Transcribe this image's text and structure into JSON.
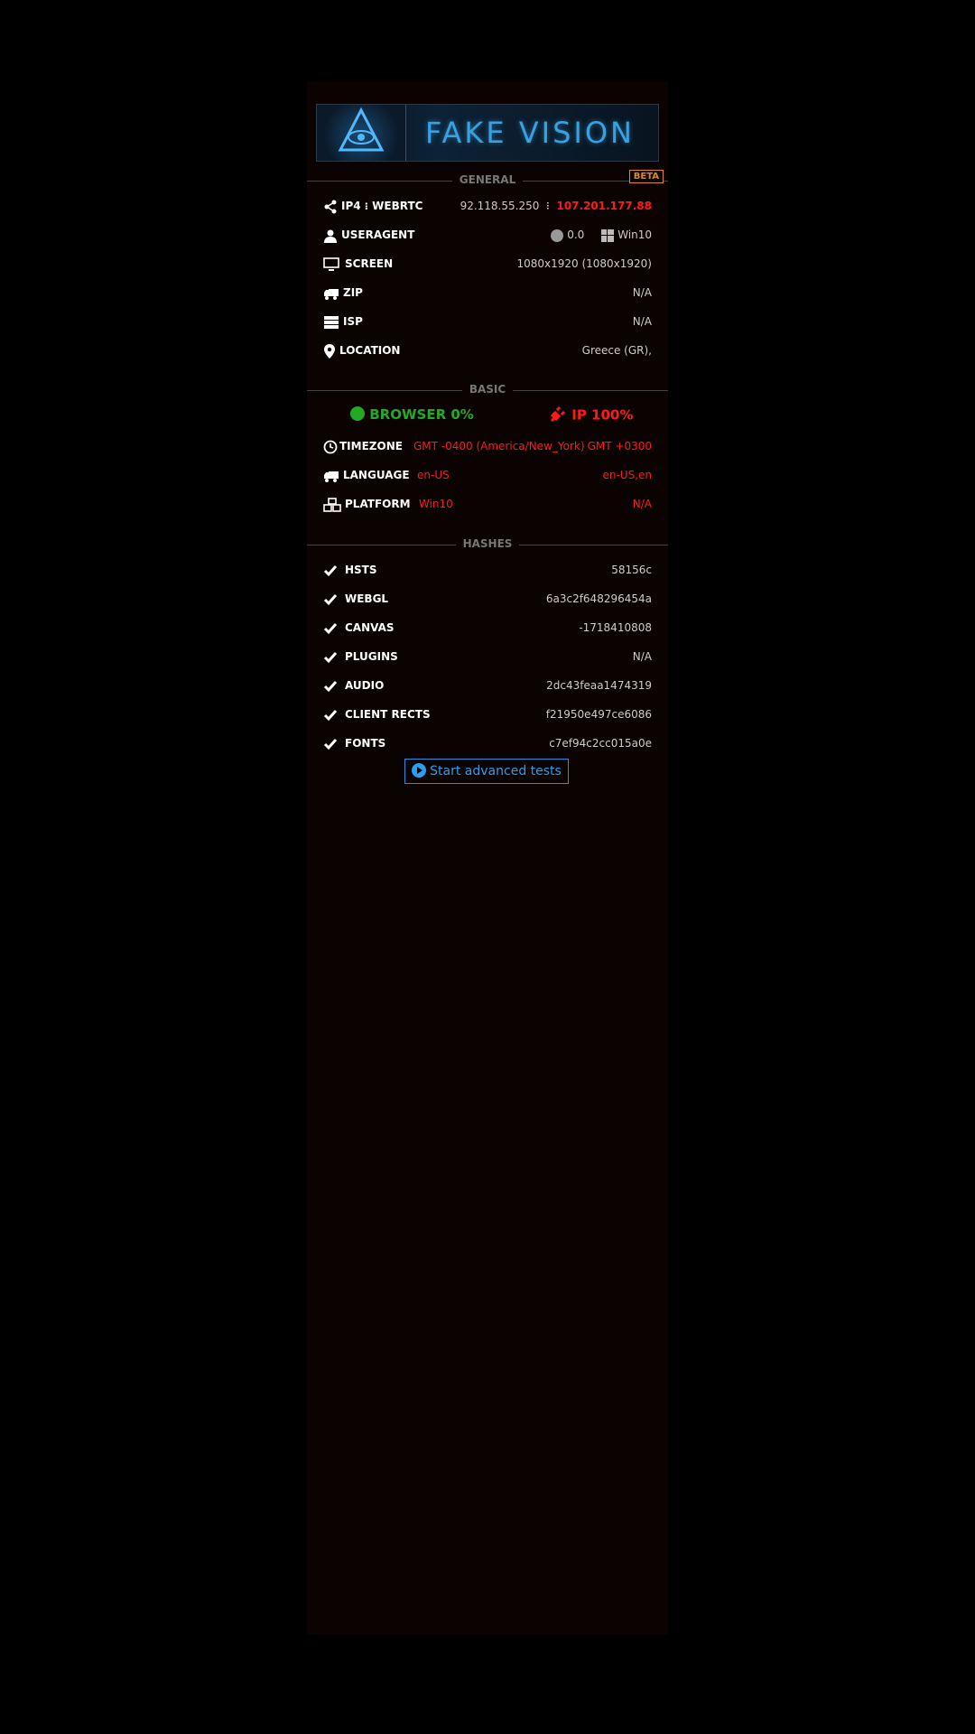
{
  "banner": {
    "title": "FAKE VISION"
  },
  "sections": {
    "general": "GENERAL",
    "basic": "BASIC",
    "hashes": "HASHES",
    "beta": "BETA"
  },
  "general": {
    "ip_label": "IP4",
    "webrtc_label": "WEBRTC",
    "ip_value": "92.118.55.250",
    "webrtc_value": "107.201.177.88",
    "useragent_label": "USERAGENT",
    "browser_version": "0.0",
    "os": "Win10",
    "screen_label": "SCREEN",
    "screen_value": "1080x1920 (1080x1920)",
    "zip_label": "ZIP",
    "zip_value": "N/A",
    "isp_label": "ISP",
    "isp_value": "N/A",
    "location_label": "LOCATION",
    "location_value": "Greece (GR),"
  },
  "basic": {
    "browser_score": "BROWSER 0%",
    "ip_score": "IP 100%",
    "timezone_label": "TIMEZONE",
    "timezone_browser": "GMT -0400 (America/New_York)",
    "timezone_ip": "GMT +0300",
    "language_label": "LANGUAGE",
    "language_browser": "en-US",
    "language_ip": "en-US,en",
    "platform_label": "PLATFORM",
    "platform_browser": "Win10",
    "platform_ip": "N/A"
  },
  "hashes": [
    {
      "label": "HSTS",
      "value": "58156c"
    },
    {
      "label": "WEBGL",
      "value": "6a3c2f648296454a"
    },
    {
      "label": "CANVAS",
      "value": "-1718410808"
    },
    {
      "label": "PLUGINS",
      "value": "N/A"
    },
    {
      "label": "AUDIO",
      "value": "2dc43feaa1474319"
    },
    {
      "label": "CLIENT RECTS",
      "value": "f21950e497ce6086"
    },
    {
      "label": "FONTS",
      "value": "c7ef94c2cc015a0e"
    }
  ],
  "actions": {
    "advanced_tests": "Start advanced tests"
  },
  "colors": {
    "accent": "#2a9ff0",
    "alert": "#ff1a1a",
    "ok": "#22aa22",
    "beta": "#e08a1a"
  }
}
